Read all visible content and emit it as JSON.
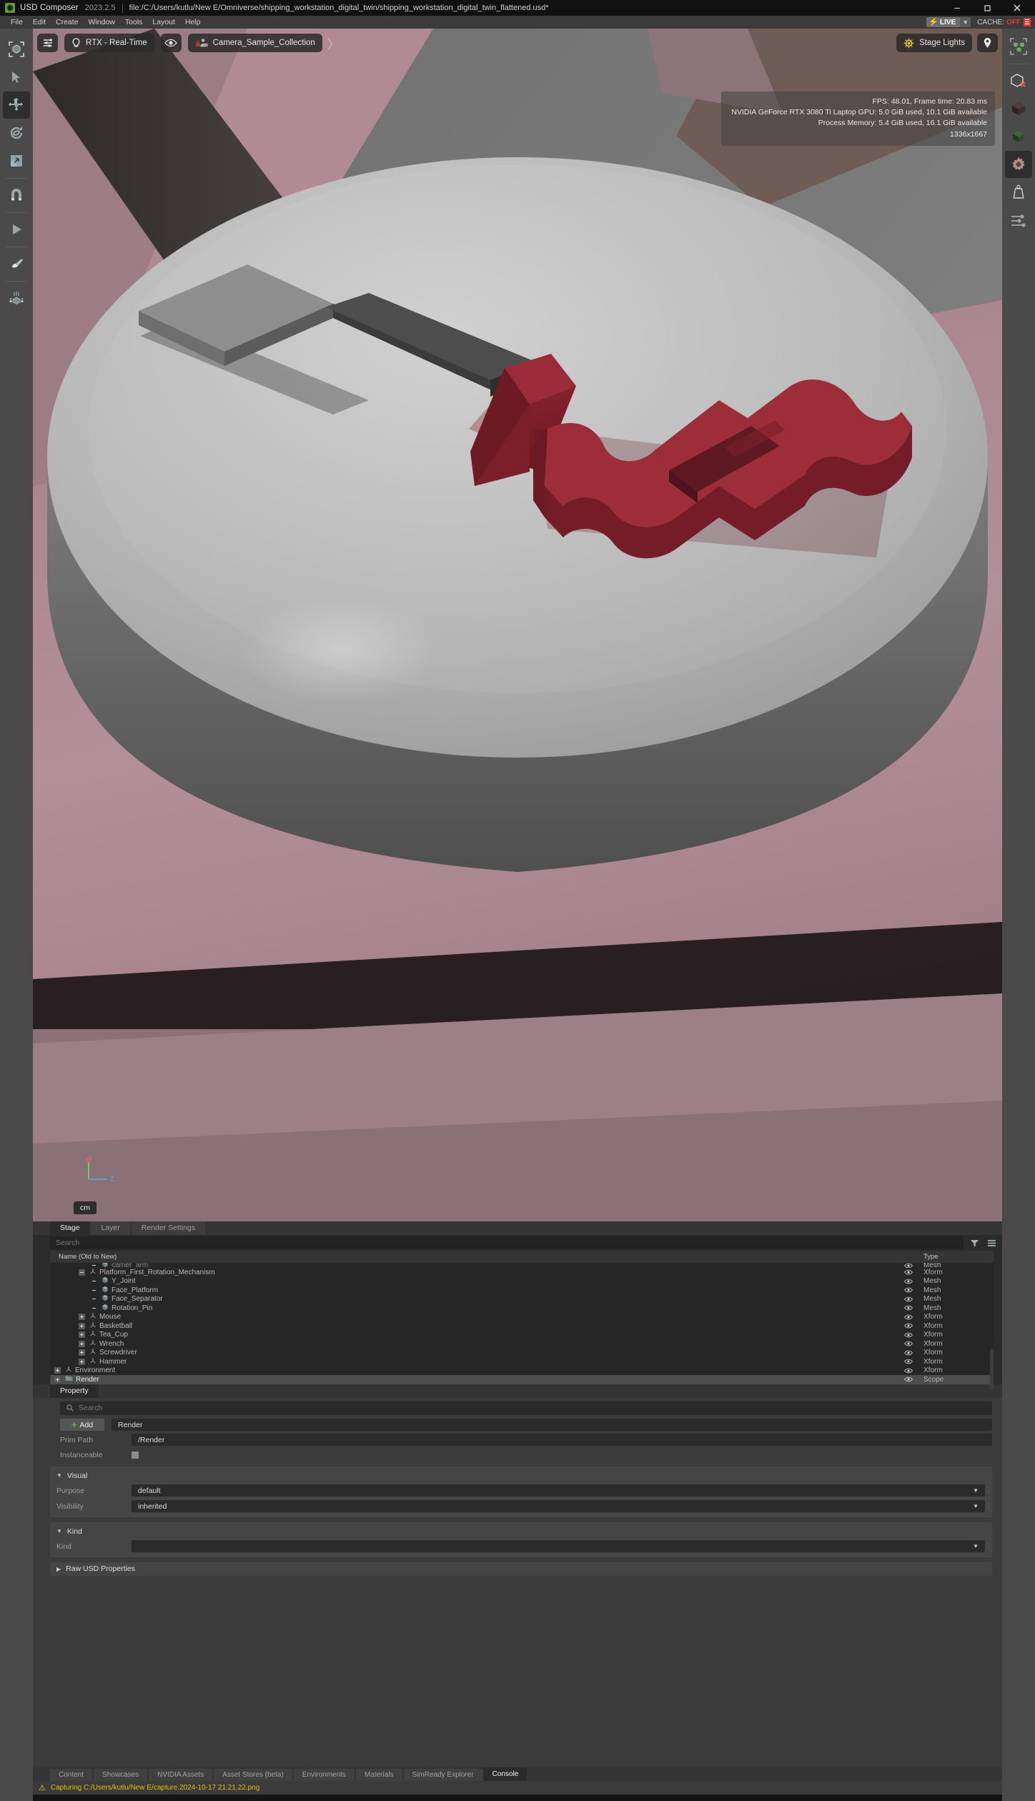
{
  "titlebar": {
    "app_name": "USD Composer",
    "version": "2023.2.5",
    "file_path": "file:/C:/Users/kutlu/New E/Omniverse/shipping_workstation_digital_twin/shipping_workstation_digital_twin_flattened.usd*",
    "minimize": "—",
    "maximize": "❐",
    "close": "✕"
  },
  "menubar": {
    "items": [
      "File",
      "Edit",
      "Create",
      "Window",
      "Tools",
      "Layout",
      "Help"
    ],
    "live_label": "LIVE",
    "live_bolt": "⚡",
    "live_caret": "▼",
    "cache_label": "CACHE:",
    "cache_value": "OFF"
  },
  "left_toolbar": {
    "items": [
      {
        "name": "select-bounding-box-tool"
      },
      {
        "name": "select-arrow-tool"
      },
      {
        "name": "move-tool",
        "active": true
      },
      {
        "name": "rotate-tool"
      },
      {
        "name": "scale-tool"
      },
      {
        "name": "snap-magnet-tool"
      },
      {
        "name": "play-tool"
      },
      {
        "name": "paint-brush-tool"
      },
      {
        "name": "physics-drop-tool"
      }
    ]
  },
  "right_toolbar": {
    "items": [
      {
        "name": "scene-objects-icon",
        "active": true
      },
      {
        "name": "hide-object-icon"
      },
      {
        "name": "dark-cube-icon"
      },
      {
        "name": "green-cube-icon"
      },
      {
        "name": "settings-gear-icon",
        "active": true
      },
      {
        "name": "weight-mass-icon"
      },
      {
        "name": "sliders-icon"
      }
    ]
  },
  "viewport": {
    "settings_icon": "sliders-icon",
    "renderer": "RTX - Real-Time",
    "eye_icon": "visibility-icon",
    "camera": "Camera_Sample_Collection",
    "chevron": "〉",
    "stage_lights": "Stage Lights",
    "location_icon": "location-pin-icon",
    "stats": [
      "FPS: 48.01, Frame time: 20.83 ms",
      "NVIDIA GeForce RTX 3080 Ti Laptop GPU: 5.0 GiB used, 10.1 GiB available",
      "Process Memory: 5.4 GiB used, 16.1 GiB available",
      "1336x1667"
    ],
    "axis_y": "Y",
    "axis_z": "Z",
    "units": "cm"
  },
  "stage_panel": {
    "tabs": [
      {
        "label": "Stage",
        "active": true
      },
      {
        "label": "Layer",
        "active": false
      },
      {
        "label": "Render Settings",
        "active": false
      }
    ],
    "search_placeholder": "Search",
    "filter_icon": "filter-funnel-icon",
    "options_icon": "list-options-icon",
    "columns": {
      "name": "Name (Old to New)",
      "type": "Type"
    },
    "rows": [
      {
        "label": "carrier_arm",
        "type": "Mesh",
        "indent": 3,
        "expander": "none",
        "icon": "mesh-icon",
        "clipped": true,
        "selected": false
      },
      {
        "label": "Platform_First_Rotation_Mechanism",
        "type": "Xform",
        "indent": 2,
        "expander": "minus",
        "icon": "xform-icon",
        "selected": false
      },
      {
        "label": "Y_Joint",
        "type": "Mesh",
        "indent": 3,
        "expander": "none",
        "icon": "mesh-icon",
        "selected": false
      },
      {
        "label": "Face_Platform",
        "type": "Mesh",
        "indent": 3,
        "expander": "none",
        "icon": "mesh-icon",
        "selected": false
      },
      {
        "label": "Face_Separator",
        "type": "Mesh",
        "indent": 3,
        "expander": "none",
        "icon": "mesh-icon",
        "selected": false
      },
      {
        "label": "Rotation_Pin",
        "type": "Mesh",
        "indent": 3,
        "expander": "none",
        "icon": "mesh-icon",
        "selected": false
      },
      {
        "label": "Mouse",
        "type": "Xform",
        "indent": 2,
        "expander": "plus",
        "icon": "xform-icon",
        "selected": false
      },
      {
        "label": "Basketball",
        "type": "Xform",
        "indent": 2,
        "expander": "plus",
        "icon": "xform-icon",
        "selected": false
      },
      {
        "label": "Tea_Cup",
        "type": "Xform",
        "indent": 2,
        "expander": "plus",
        "icon": "xform-icon",
        "selected": false
      },
      {
        "label": "Wrench",
        "type": "Xform",
        "indent": 2,
        "expander": "plus",
        "icon": "xform-icon",
        "selected": false
      },
      {
        "label": "Screwdriver",
        "type": "Xform",
        "indent": 2,
        "expander": "plus",
        "icon": "xform-icon",
        "selected": false
      },
      {
        "label": "Hammer",
        "type": "Xform",
        "indent": 2,
        "expander": "plus",
        "icon": "xform-icon",
        "selected": false
      },
      {
        "label": "Environment",
        "type": "Xform",
        "indent": 0,
        "expander": "plus",
        "icon": "xform-icon",
        "selected": false
      },
      {
        "label": "Render",
        "type": "Scope",
        "indent": 0,
        "expander": "plus",
        "icon": "scope-folder-icon",
        "selected": true
      }
    ]
  },
  "property_panel": {
    "tabs": [
      {
        "label": "Property",
        "active": true
      }
    ],
    "search_placeholder": "Search",
    "search_icon": "search-icon",
    "add_label": "Add",
    "prim_name": "Render",
    "prim_path_label": "Prim Path",
    "prim_path_value": "/Render",
    "instanceable_label": "Instanceable",
    "instanceable_checked": false,
    "sections": [
      {
        "title": "Visual",
        "expanded": true,
        "rows": [
          {
            "label": "Purpose",
            "value": "default",
            "dropdown": true
          },
          {
            "label": "Visibility",
            "value": "inherited",
            "dropdown": true
          }
        ]
      },
      {
        "title": "Kind",
        "expanded": true,
        "rows": [
          {
            "label": "Kind",
            "value": "",
            "dropdown": true
          }
        ]
      },
      {
        "title": "Raw USD Properties",
        "expanded": false,
        "rows": []
      }
    ]
  },
  "bottom_tabs": [
    {
      "label": "Content",
      "active": false
    },
    {
      "label": "Showcases",
      "active": false
    },
    {
      "label": "NVIDIA Assets",
      "active": false
    },
    {
      "label": "Asset Stores (beta)",
      "active": false
    },
    {
      "label": "Environments",
      "active": false
    },
    {
      "label": "Materials",
      "active": false
    },
    {
      "label": "SimReady Explorer",
      "active": false
    },
    {
      "label": "Console",
      "active": true
    }
  ],
  "status_bar": {
    "warning_icon": "warning-triangle-icon",
    "message": "Capturing C:/Users/kutlu/New E/capture.2024-10-17 21.21.22.png"
  },
  "colors": {
    "accent_green": "#64b44f",
    "live_yellow": "#f5d400",
    "cache_red": "#e03a32",
    "status_yellow": "#d8c400",
    "selection_gray": "#4d4d4d"
  }
}
